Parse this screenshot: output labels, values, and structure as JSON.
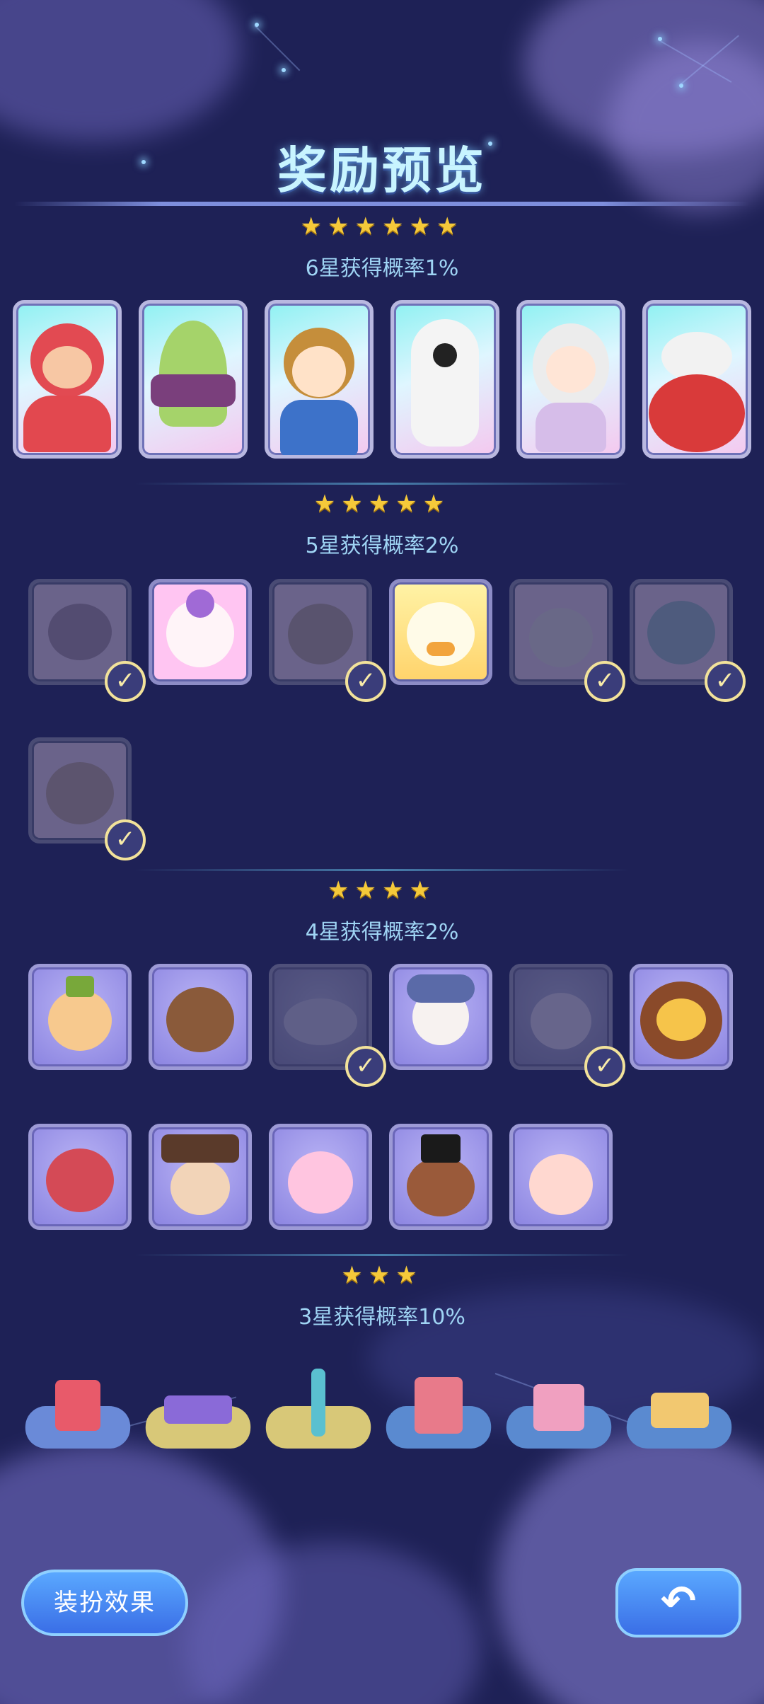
{
  "title": "奖励预览",
  "tiers": [
    {
      "stars": "★★★★★★",
      "label": "6星获得概率1%"
    },
    {
      "stars": "★★★★★",
      "label": "5星获得概率2%"
    },
    {
      "stars": "★★★★",
      "label": "4星获得概率2%"
    },
    {
      "stars": "★★★",
      "label": "3星获得概率10%"
    }
  ],
  "check_mark": "✓",
  "buttons": {
    "dress_up": "装扮效果",
    "back_icon": "undo-icon",
    "back_glyph": "↶"
  },
  "colors": {
    "background": "#1e2156",
    "star": "#f5c93a",
    "probability_text": "#9fd4f4",
    "title": "#c8f4ff",
    "button": "#4a8cf2"
  }
}
